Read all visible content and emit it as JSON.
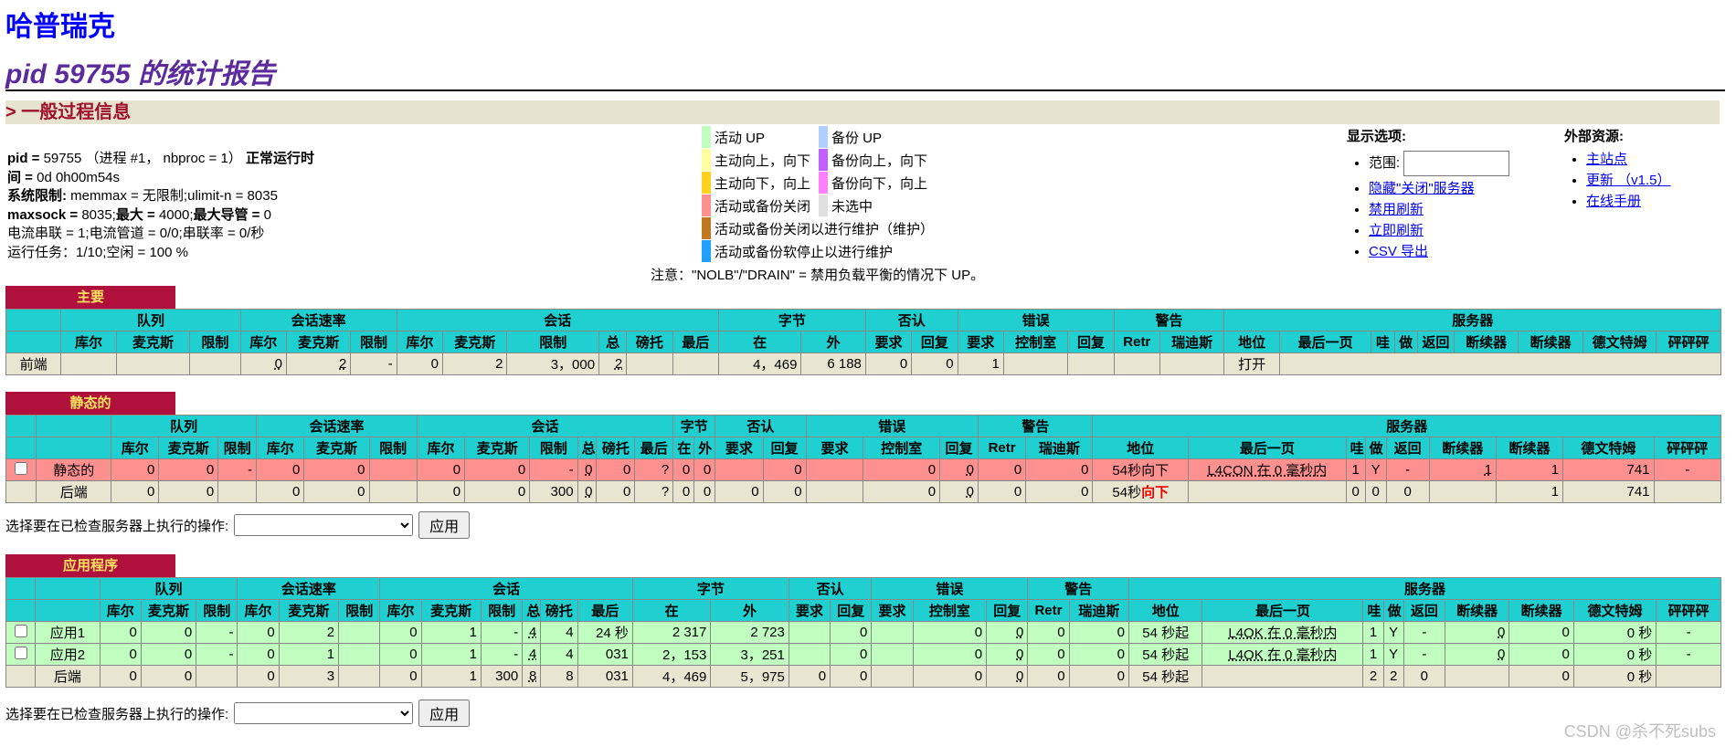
{
  "header": {
    "title": "哈普瑞克",
    "subtitle": "pid 59755 的统计报告"
  },
  "section": {
    "title": "> 一般过程信息"
  },
  "process": {
    "line1_label": "pid =",
    "line1_value": "59755 （进程 #1， nbproc = 1）",
    "uptime_label": "正常运行时间 =",
    "uptime_value": "0d 0h00m54s",
    "syslimit_label": "系统限制:",
    "syslimit_value": "memmax = 无限制;ulimit-n = 8035",
    "maxsock_label": "maxsock =",
    "maxsock_value": "8035;",
    "maxconn_label": "最大 =",
    "maxconn_value": "4000;",
    "maxpipes_label": "最大导管 =",
    "maxpipes_value": "0",
    "line5": "电流串联 = 1;电流管道 = 0/0;串联率 = 0/秒",
    "line6": "运行任务：1/10;空闲 = 100 %"
  },
  "legend": {
    "items": [
      {
        "label": "活动 UP",
        "color": "#c0ffc0"
      },
      {
        "label": "主动向上，向下",
        "color": "#ffffa0"
      },
      {
        "label": "主动向下，向上",
        "color": "#ffd020"
      },
      {
        "label": "活动或备份关闭",
        "color": "#ff9090"
      },
      {
        "label": "活动或备份关闭以进行维护（维护）",
        "color": "#c07820"
      },
      {
        "label": "活动或备份软停止以进行维护",
        "color": "#20a0ff"
      },
      {
        "label": "备份 UP",
        "color": "#b0d0ff"
      },
      {
        "label": "备份向上，向下",
        "color": "#c060ff"
      },
      {
        "label": "备份向下，向上",
        "color": "#ff80ff"
      },
      {
        "label": "未选中",
        "color": "#e0e0e0"
      }
    ],
    "note": "注意：\"NOLB\"/\"DRAIN\" = 禁用负载平衡的情况下 UP。"
  },
  "display_options": {
    "title": "显示选项:",
    "range_label": "范围:",
    "range_value": "",
    "links": [
      "隐藏\"关闭\"服务器",
      "禁用刷新",
      "立即刷新",
      "CSV 导出"
    ]
  },
  "external": {
    "title": "外部资源:",
    "links": [
      "主站点",
      "更新 （v1.5）",
      "在线手册"
    ]
  },
  "tables": {
    "main": {
      "label": "主要",
      "groups": [
        "队列",
        "会话速率",
        "会话",
        "字节",
        "否认",
        "错误",
        "警告",
        "服务器"
      ],
      "cols": [
        "库尔",
        "麦克斯",
        "限制",
        "库尔",
        "麦克斯",
        "限制",
        "库尔",
        "麦克斯",
        "限制",
        "总",
        "磅托",
        "最后",
        "在",
        "外",
        "要求",
        "回复",
        "要求",
        "控制室",
        "回复",
        "Retr",
        "瑞迪斯",
        "地位",
        "最后一页",
        "哇",
        "做",
        "返回",
        "断续器",
        "断续器",
        "德文特姆",
        "砰砰砰"
      ],
      "row": {
        "name": "前端",
        "c1": "",
        "c2": "",
        "c3": "",
        "c4": "0",
        "c5": "2",
        "c6": "-",
        "c7": "0",
        "c8": "2",
        "c9": "3，000",
        "c10": "2",
        "c11": "",
        "c12": "",
        "c13": "4，469",
        "c14": "6 188",
        "c15": "0",
        "c16": "0",
        "c17": "1",
        "status": "打开"
      }
    },
    "static": {
      "label": "静态的",
      "rows": [
        {
          "name": "静态的",
          "c": [
            "0",
            "0",
            "-",
            "0",
            "0",
            "",
            "0",
            "0",
            "-",
            "0",
            "0",
            "?",
            "0",
            "0",
            "",
            "0",
            "",
            "0",
            "0",
            "0",
            "0"
          ],
          "status": "54秒向下",
          "lastchk": "L4CON 在 0 毫秒内",
          "wght": "1",
          "act": "Y",
          "bck": "-",
          "chk": "1",
          "dwn": "1",
          "dwntme": "741",
          "thrtle": "-"
        },
        {
          "name": "后端",
          "c": [
            "0",
            "0",
            "",
            "0",
            "0",
            "",
            "0",
            "0",
            "300",
            "0",
            "0",
            "?",
            "0",
            "0",
            "0",
            "0",
            "",
            "0",
            "0",
            "0",
            "0"
          ],
          "status_a": "54秒",
          "status_b": "向下",
          "lastchk": "",
          "wght": "0",
          "act": "0",
          "bck": "0",
          "chk": "",
          "dwn": "1",
          "dwntme": "741",
          "thrtle": ""
        }
      ]
    },
    "app": {
      "label": "应用程序",
      "rows": [
        {
          "name": "应用1",
          "c": [
            "0",
            "0",
            "-",
            "0",
            "2",
            "",
            "0",
            "1",
            "-",
            "4",
            "4",
            "24 秒",
            "2 317",
            "2 723",
            "",
            "0",
            "",
            "0",
            "0",
            "0",
            "0"
          ],
          "status": "54 秒起",
          "lastchk": "L4OK 在 0 毫秒内",
          "wght": "1",
          "act": "Y",
          "bck": "-",
          "chk": "0",
          "dwn": "0",
          "dwntme": "0 秒",
          "thrtle": "-"
        },
        {
          "name": "应用2",
          "c": [
            "0",
            "0",
            "-",
            "0",
            "1",
            "",
            "0",
            "1",
            "-",
            "4",
            "4",
            "031",
            "2，153",
            "3，251",
            "",
            "0",
            "",
            "0",
            "0",
            "0",
            "0"
          ],
          "status": "54 秒起",
          "lastchk": "L4OK 在 0 毫秒内",
          "wght": "1",
          "act": "Y",
          "bck": "-",
          "chk": "0",
          "dwn": "0",
          "dwntme": "0 秒",
          "thrtle": "-"
        },
        {
          "name": "后端",
          "c": [
            "0",
            "0",
            "",
            "0",
            "3",
            "",
            "0",
            "1",
            "300",
            "8",
            "8",
            "031",
            "4，469",
            "5，975",
            "0",
            "0",
            "",
            "0",
            "0",
            "0",
            "0"
          ],
          "status": "54 秒起",
          "lastchk": "",
          "wght": "2",
          "act": "2",
          "bck": "0",
          "chk": "",
          "dwn": "0",
          "dwntme": "0 秒",
          "thrtle": ""
        }
      ]
    }
  },
  "actions": {
    "label": "选择要在已检查服务器上执行的操作:",
    "apply": "应用"
  },
  "watermark": "CSDN @杀不死subs"
}
